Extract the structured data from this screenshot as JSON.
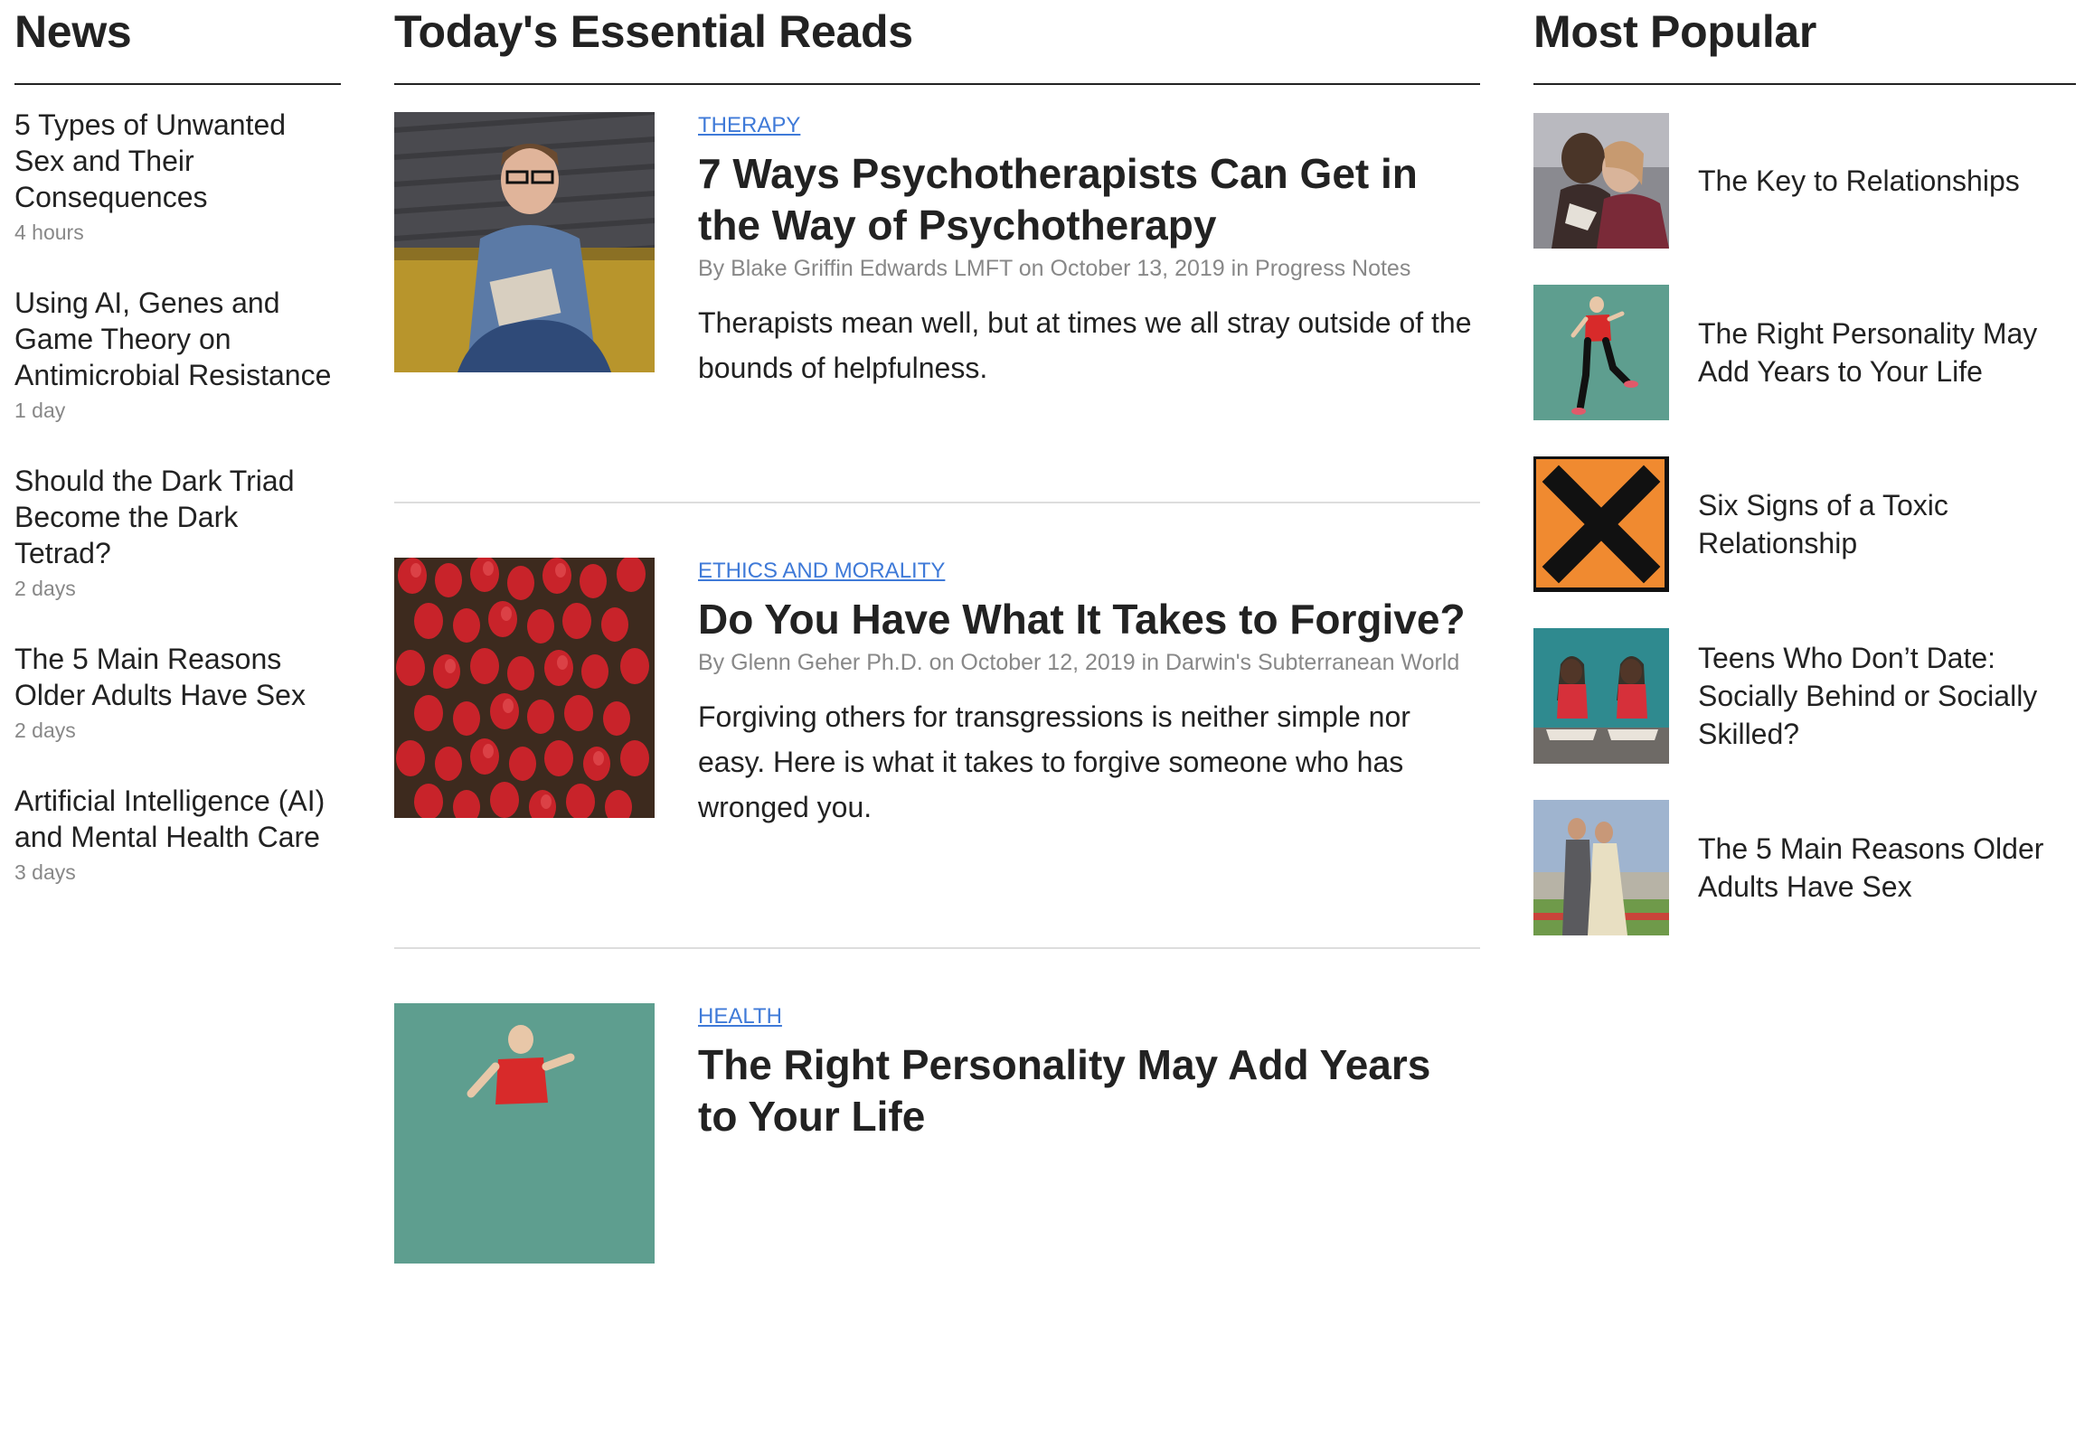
{
  "news": {
    "title": "News",
    "items": [
      {
        "title": "5 Types of Unwanted Sex and Their Consequences",
        "time": "4 hours"
      },
      {
        "title": "Using AI, Genes and Game Theory on Antimicrobial Resistance",
        "time": "1 day"
      },
      {
        "title": "Should the Dark Triad Become the Dark Tetrad?",
        "time": "2 days"
      },
      {
        "title": "The 5 Main Reasons Older Adults Have Sex",
        "time": "2 days"
      },
      {
        "title": "Artificial Intelligence (AI) and Mental Health Care",
        "time": "3 days"
      }
    ]
  },
  "reads": {
    "title": "Today's Essential Reads",
    "items": [
      {
        "category": "THERAPY",
        "title": "7 Ways Psychotherapists Can Get in the Way of Psychotherapy",
        "meta": "By Blake Griffin Edwards LMFT on October 13, 2019 in Progress Notes",
        "description": "Therapists mean well, but at times we all stray outside of the bounds of helpfulness."
      },
      {
        "category": "ETHICS AND MORALITY",
        "title": "Do You Have What It Takes to Forgive?",
        "meta": "By Glenn Geher Ph.D. on October 12, 2019 in Darwin's Subterranean World",
        "description": "Forgiving others for transgressions is neither simple nor easy. Here is what it takes to forgive someone who has wronged you."
      },
      {
        "category": "HEALTH",
        "title": "The Right Personality May Add Years to Your Life",
        "meta": "",
        "description": ""
      }
    ]
  },
  "popular": {
    "title": "Most Popular",
    "items": [
      {
        "title": "The Key to Relationships"
      },
      {
        "title": "The Right Personality May Add Years to Your Life"
      },
      {
        "title": "Six Signs of a Toxic Relationship"
      },
      {
        "title": "Teens Who Don’t Date: Socially Behind or Socially Skilled?"
      },
      {
        "title": "The 5 Main Reasons Older Adults Have Sex"
      }
    ]
  },
  "colors": {
    "category": "#3f7ad8",
    "meta": "#888888",
    "text": "#222222",
    "divider": "#dddddd"
  }
}
